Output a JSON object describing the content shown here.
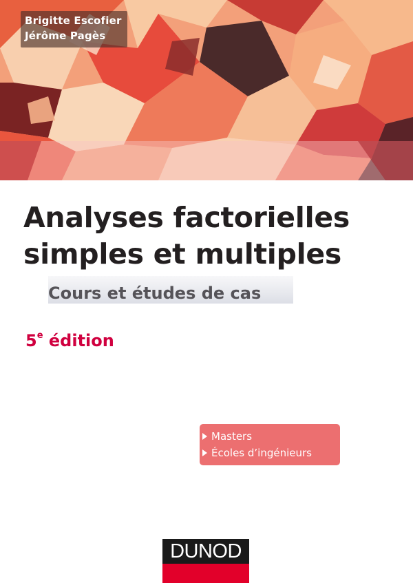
{
  "authors": [
    "Brigitte Escofier",
    "Jérôme Pagès"
  ],
  "title_lines": [
    "Analyses factorielles",
    "simples et multiples"
  ],
  "subtitle": "Cours et études de cas",
  "edition": {
    "number": "5",
    "suffix": "e",
    "label": "édition"
  },
  "audience": [
    "Masters",
    "Écoles d’ingénieurs"
  ],
  "publisher": "DUNOD",
  "colors": {
    "accent_red": "#d0003f",
    "audience_box": "#ec6f70",
    "publisher_red": "#e2002a",
    "title_text": "#231f20"
  }
}
